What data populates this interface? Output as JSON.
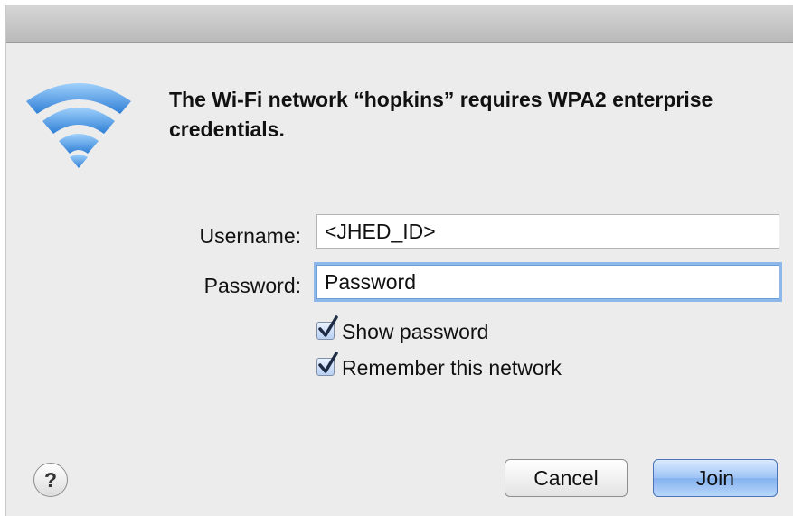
{
  "dialog": {
    "message": "The Wi-Fi network “hopkins” requires WPA2 enterprise credentials.",
    "icon": "wifi-icon"
  },
  "form": {
    "username_label": "Username:",
    "username_value": "<JHED_ID>",
    "password_label": "Password:",
    "password_value": "Password"
  },
  "options": {
    "show_password": {
      "label": "Show password",
      "checked": true
    },
    "remember_network": {
      "label": "Remember this network",
      "checked": true
    }
  },
  "buttons": {
    "help": "?",
    "cancel": "Cancel",
    "join": "Join"
  },
  "colors": {
    "wifi_blue": "#3a8fe0",
    "focus_ring": "#8fb8ea",
    "default_button": "#9cc3f5"
  }
}
